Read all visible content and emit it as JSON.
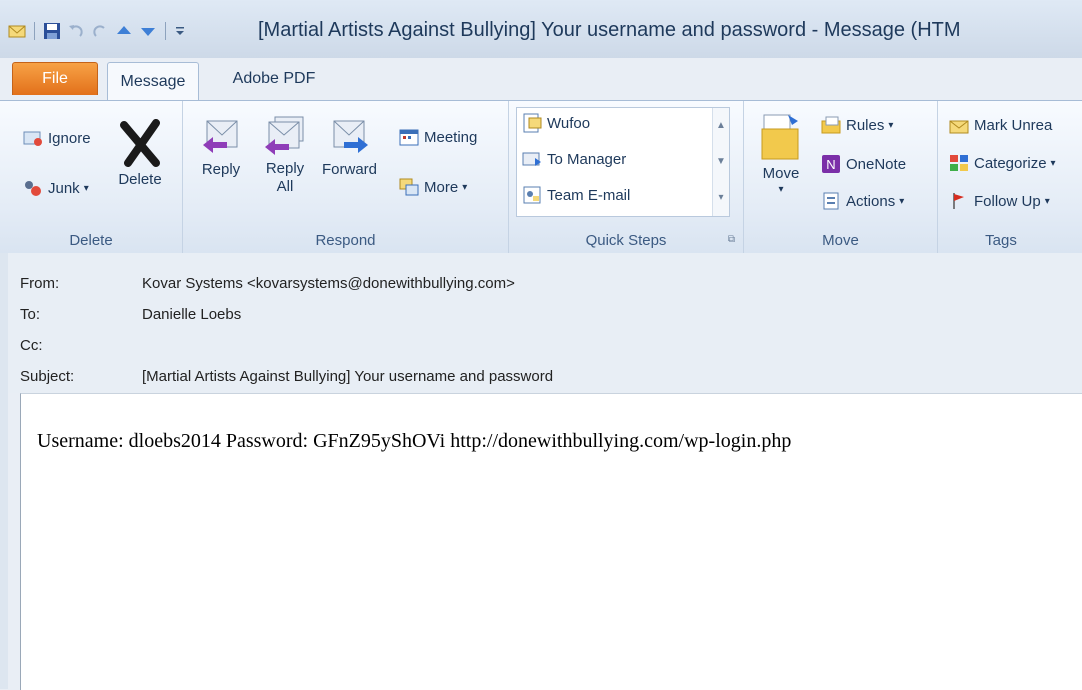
{
  "window": {
    "title": "[Martial Artists Against Bullying] Your username and password  -  Message (HTM"
  },
  "tabs": {
    "file": "File",
    "message": "Message",
    "adobe_pdf": "Adobe PDF"
  },
  "ribbon": {
    "delete_group": {
      "label": "Delete",
      "ignore": "Ignore",
      "junk": "Junk",
      "delete": "Delete"
    },
    "respond_group": {
      "label": "Respond",
      "reply": "Reply",
      "reply_all_1": "Reply",
      "reply_all_2": "All",
      "forward": "Forward",
      "meeting": "Meeting",
      "more": "More"
    },
    "quick_steps": {
      "label": "Quick Steps",
      "items": [
        "Wufoo",
        "To Manager",
        "Team E-mail"
      ]
    },
    "move_group": {
      "label": "Move",
      "move": "Move",
      "rules": "Rules",
      "onenote": "OneNote",
      "actions": "Actions"
    },
    "tags_group": {
      "label": "Tags",
      "mark_unread": "Mark Unrea",
      "categorize": "Categorize",
      "follow_up": "Follow Up"
    }
  },
  "header": {
    "from_label": "From:",
    "from_value": "Kovar Systems <kovarsystems@donewithbullying.com>",
    "to_label": "To:",
    "to_value": "Danielle Loebs",
    "cc_label": "Cc:",
    "subject_label": "Subject:",
    "subject_value": "[Martial Artists Against Bullying] Your username and password"
  },
  "body": {
    "text": "Username: dloebs2014 Password: GFnZ95yShOVi http://donewithbullying.com/wp-login.php"
  },
  "colors": {
    "file_tab": "#e2701a",
    "accent": "#1e395b"
  }
}
